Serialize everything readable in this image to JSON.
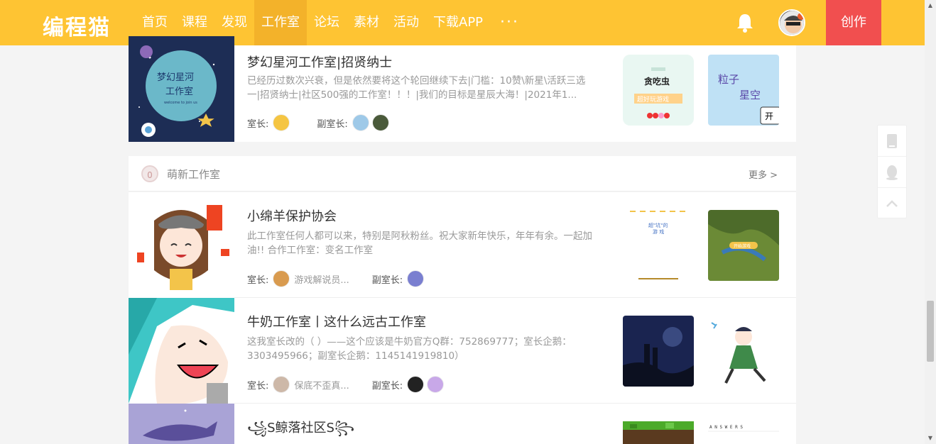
{
  "header": {
    "logo": "编程猫",
    "nav": [
      "首页",
      "课程",
      "发现",
      "工作室",
      "论坛",
      "素材",
      "活动",
      "下载APP"
    ],
    "nav_more": "···",
    "create": "创作"
  },
  "top_row": {
    "title": "梦幻星河工作室|招贤纳士",
    "desc": "已经历过数次兴衰，但是依然要将这个轮回继续下去|门槛：10赞\\新星\\活跃三选一|招贤纳士|社区500强的工作室！！！|我们的目标是星辰大海！|2021年1...",
    "leader_label": "室长:",
    "vice_label": "副室长:",
    "cover_text": "梦幻星河\n工作室",
    "cover_sub": "welcome to join us",
    "thumb1": {
      "title": "贪吃虫",
      "sub": "超好玩游戏"
    },
    "thumb2": {
      "title": "粒子",
      "title2": "星空",
      "tag": "开"
    }
  },
  "section": {
    "badge": "0",
    "title": "萌新工作室",
    "more": "更多 >"
  },
  "rows": [
    {
      "title": "小绵羊保护协会",
      "desc": "此工作室任何人都可以来，特别是阿秋粉丝。祝大家新年快乐，年年有余。一起加油!! 合作工作室：变名工作室",
      "leader_label": "室长:",
      "leader_name": "游戏解说员...",
      "vice_label": "副室长:",
      "thumb1_text": "超\"坑\"的\n游戏",
      "thumb2_text": "开始游戏"
    },
    {
      "title": "牛奶工作室丨这什么远古工作室",
      "desc": "这我室长改的（ ）——这个应该是牛奶官方Q群：752869777；室长企鹅：3303495966；副室长企鹅：1145141919810）",
      "leader_label": "室长:",
      "leader_name": "保底不歪真...",
      "vice_label": "副室长:"
    },
    {
      "title": "꧁S鲸落社区S꧂",
      "desc": "",
      "thumb2_text": "A N S W E R S"
    }
  ],
  "colors": {
    "brand": "#fec433",
    "nav_active": "#f3b22a",
    "create": "#f14f4f"
  }
}
